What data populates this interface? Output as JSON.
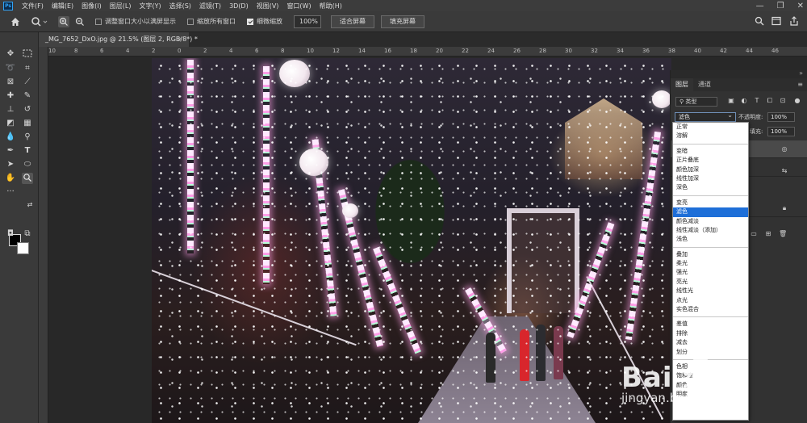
{
  "app": {
    "logo": "Ps"
  },
  "menu": [
    "文件(F)",
    "编辑(E)",
    "图像(I)",
    "图层(L)",
    "文字(Y)",
    "选择(S)",
    "滤镜(T)",
    "3D(D)",
    "视图(V)",
    "窗口(W)",
    "帮助(H)"
  ],
  "window_controls": {
    "minimize": "—",
    "restore": "❐",
    "close": "✕"
  },
  "options_bar": {
    "resize_windows_label": "调整窗口大小以满屏显示",
    "zoom_all_windows_label": "缩放所有窗口",
    "scrubby_zoom_label": "细微缩放",
    "scrubby_zoom_checked": true,
    "zoom_value": "100%",
    "fit_screen_label": "适合屏幕",
    "fill_screen_label": "填充屏幕"
  },
  "document_tab": {
    "title": "_MG_7652_DxO.jpg @ 21.5% (图层 2, RGB/8*) *",
    "close": "×"
  },
  "ruler_top": [
    "10",
    "8",
    "6",
    "4",
    "2",
    "0",
    "2",
    "4",
    "6",
    "8",
    "10",
    "12",
    "14",
    "16",
    "18",
    "20",
    "22",
    "24",
    "26",
    "28",
    "30",
    "32",
    "34",
    "36",
    "38",
    "40",
    "42",
    "44",
    "46"
  ],
  "layers_panel": {
    "tabs": [
      "图层",
      "通道"
    ],
    "kind_filter": "类型",
    "blend_mode": "滤色",
    "opacity_label": "不透明度:",
    "opacity_value": "100%",
    "fill_label": "填充:",
    "fill_value": "100%"
  },
  "blend_modes": [
    [
      "正常",
      "溶解"
    ],
    [
      "变暗",
      "正片叠底",
      "颜色加深",
      "线性加深",
      "深色"
    ],
    [
      "变亮",
      "滤色",
      "颜色减淡",
      "线性减淡（添加）",
      "浅色"
    ],
    [
      "叠加",
      "柔光",
      "强光",
      "亮光",
      "线性光",
      "点光",
      "实色混合"
    ],
    [
      "差值",
      "排除",
      "减去",
      "划分"
    ],
    [
      "色相",
      "饱和度",
      "颜色",
      "明度"
    ]
  ],
  "selected_blend_mode": "滤色",
  "watermark": {
    "logo_text": "Bai  经验",
    "url_text": "jingyan.baidu.com"
  },
  "colors": {
    "foreground": "#000000",
    "background": "#ffffff",
    "selection": "#1e6fd8"
  }
}
